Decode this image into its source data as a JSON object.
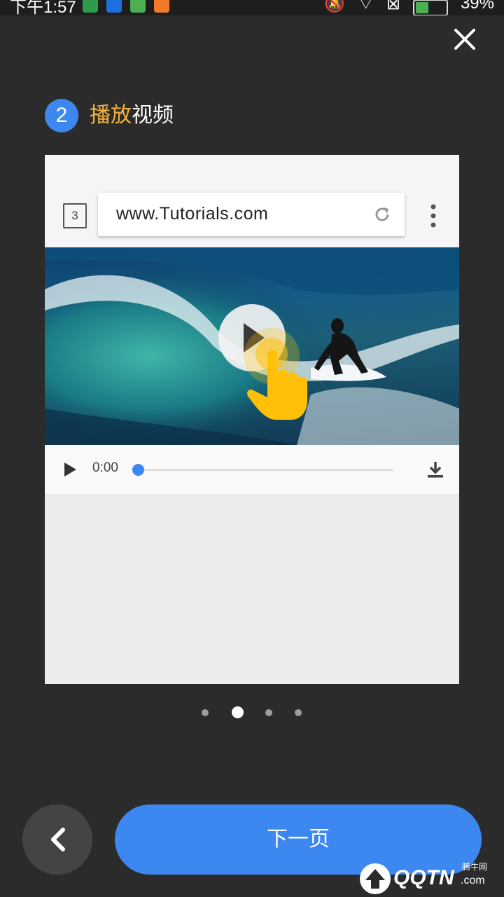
{
  "status_bar": {
    "time": "下午1:57",
    "battery": "39%",
    "app_icons": [
      {
        "name": "app-icon-1",
        "color": "#2d9c4a"
      },
      {
        "name": "app-icon-2",
        "color": "#1e6fe0"
      },
      {
        "name": "app-icon-3",
        "color": "#4caf50"
      },
      {
        "name": "app-icon-4",
        "color": "#f07a2a"
      }
    ],
    "icons": [
      "mute-icon",
      "wifi-icon",
      "sim-icon",
      "battery-icon"
    ]
  },
  "header": {
    "close_icon": "close-icon",
    "step_number": "2",
    "title_highlight": "播放",
    "title_rest": "视频"
  },
  "tutorial_browser": {
    "tab_count": "3",
    "url": "www.Tutorials.com",
    "reload_icon": "reload-icon",
    "menu_icon": "more-vert-icon"
  },
  "video_player": {
    "thumbnail": "surfer-on-wave",
    "time": "0:00",
    "progress": 0,
    "play_icon": "play-icon",
    "download_icon": "download-icon",
    "tap_hint_icon": "tap-hand-icon"
  },
  "pager": {
    "count": 4,
    "active_index": 1
  },
  "footer": {
    "back_icon": "chevron-left-icon",
    "next_label": "下一页"
  },
  "watermark": {
    "brand": "QQTN",
    "suffix": ".com",
    "cn": "腾牛网"
  },
  "colors": {
    "background": "#2b2b2b",
    "accent": "#3d87f0",
    "highlight": "#f3b33d",
    "hand": "#ffc107"
  }
}
